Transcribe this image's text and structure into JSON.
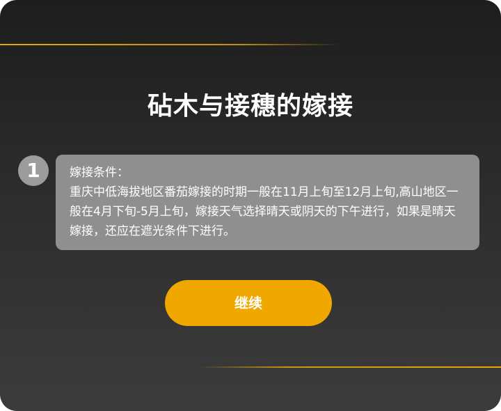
{
  "dialog": {
    "title": "砧木与接穗的嫁接",
    "step_number": "1",
    "card_heading": "嫁接条件：",
    "card_body": "重庆中低海拔地区番茄嫁接的时期一般在11月上旬至12月上旬,高山地区一般在4月下旬-5月上旬，嫁接天气选择晴天或阴天的下午进行，如果是晴天嫁接，还应在遮光条件下进行。",
    "continue_label": "继续"
  },
  "colors": {
    "accent": "#f0a800",
    "card_background": "#8f8f8f",
    "badge_background": "#9c9c9c",
    "dialog_background": "#2a2a2a"
  }
}
